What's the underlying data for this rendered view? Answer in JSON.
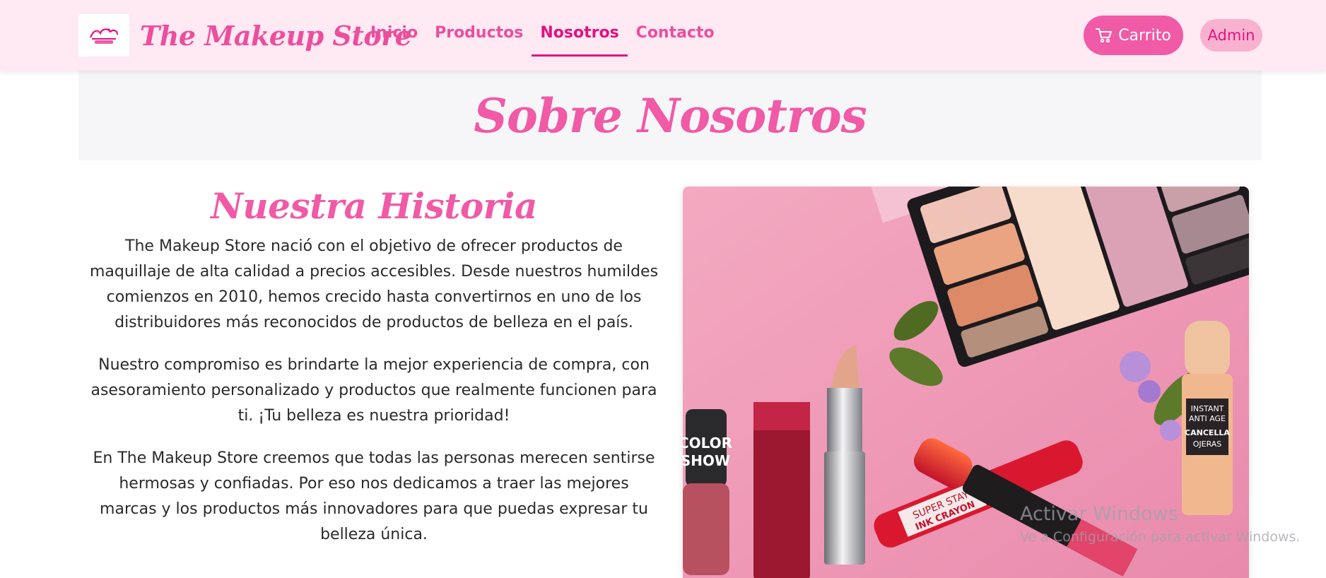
{
  "header": {
    "brand": "The Makeup Store",
    "nav": [
      {
        "label": "Inicio",
        "active": false
      },
      {
        "label": "Productos",
        "active": false
      },
      {
        "label": "Nosotros",
        "active": true
      },
      {
        "label": "Contacto",
        "active": false
      }
    ],
    "cart_label": "Carrito",
    "admin_label": "Admin"
  },
  "hero": {
    "title": "Sobre Nosotros"
  },
  "story": {
    "title": "Nuestra Historia",
    "paragraphs": [
      "The Makeup Store nació con el objetivo de ofrecer productos de maquillaje de alta calidad a precios accesibles. Desde nuestros humildes comienzos en 2010, hemos crecido hasta convertirnos en uno de los distribuidores más reconocidos de productos de belleza en el país.",
      "Nuestro compromiso es brindarte la mejor experiencia de compra, con asesoramiento personalizado y productos que realmente funcionen para ti. ¡Tu belleza es nuestra prioridad!",
      "En The Makeup Store creemos que todas las personas merecen sentirse hermosas y confiadas. Por eso nos dedicamos a traer las mejores marcas y los productos más innovadores para que puedas expresar tu belleza única."
    ]
  },
  "photo": {
    "product_labels": {
      "nail_polish": [
        "COLOR",
        "SHOW"
      ],
      "crayon": [
        "SUPER STAY",
        "INK CRAYON"
      ],
      "concealer": [
        "INSTANT",
        "ANTI AGE",
        "CANCELLA",
        "OJERAS"
      ]
    }
  },
  "watermark": {
    "title": "Activar Windows",
    "subtitle": "Ve a Configuración para activar Windows."
  },
  "colors": {
    "accent": "#f05aa6",
    "accent_dark": "#e3117f",
    "navbar_bg": "#ffe9f2",
    "hero_bg": "#f6f6f8"
  }
}
